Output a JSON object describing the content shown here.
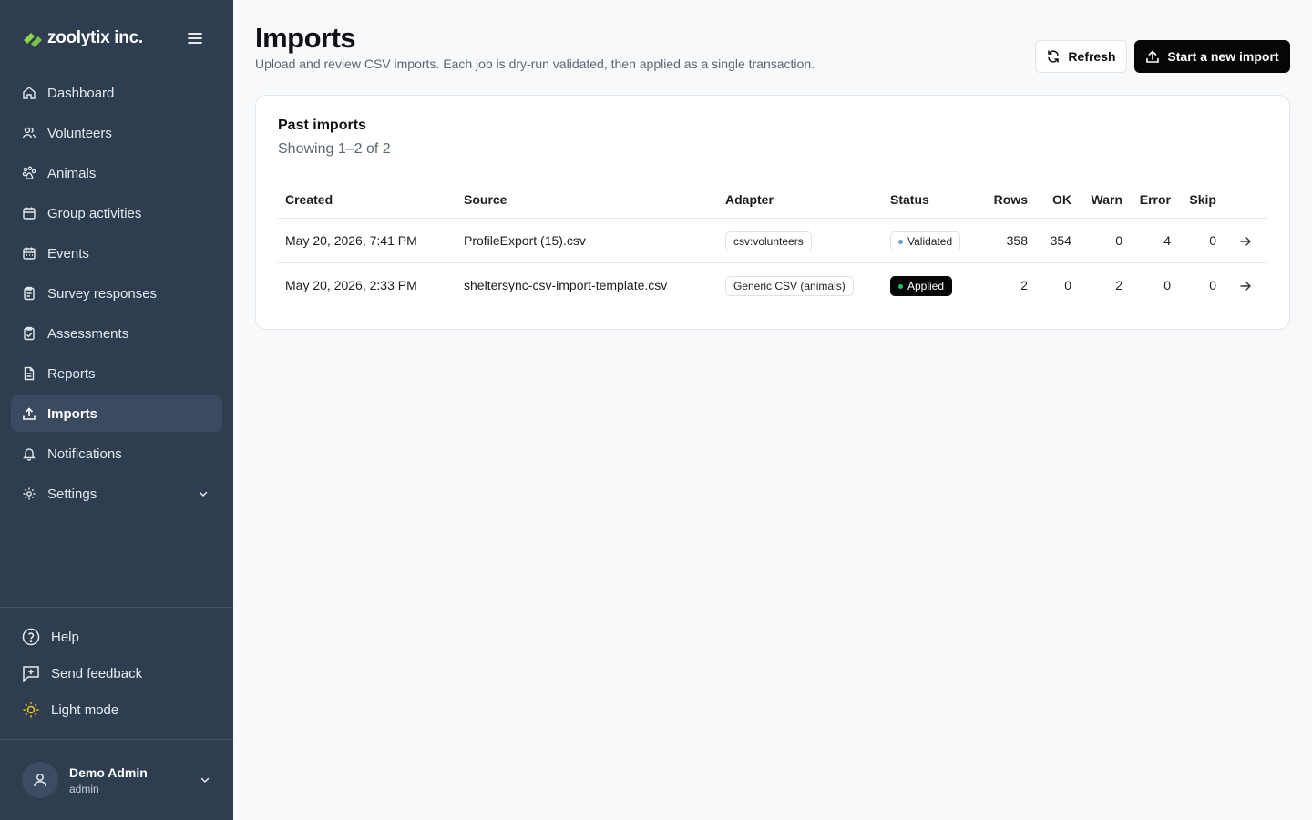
{
  "brand": {
    "name": "zoolytix inc."
  },
  "sidebar": {
    "items": [
      {
        "label": "Dashboard",
        "icon": "home-icon"
      },
      {
        "label": "Volunteers",
        "icon": "users-icon"
      },
      {
        "label": "Animals",
        "icon": "paw-icon"
      },
      {
        "label": "Group activities",
        "icon": "calendar-icon"
      },
      {
        "label": "Events",
        "icon": "calendar-icon"
      },
      {
        "label": "Survey responses",
        "icon": "clipboard-icon"
      },
      {
        "label": "Assessments",
        "icon": "clipboard-check-icon"
      },
      {
        "label": "Reports",
        "icon": "document-icon"
      },
      {
        "label": "Imports",
        "icon": "upload-icon",
        "active": true
      },
      {
        "label": "Notifications",
        "icon": "bell-icon"
      },
      {
        "label": "Settings",
        "icon": "gear-icon",
        "expandable": true
      }
    ],
    "utilities": [
      {
        "label": "Help",
        "icon": "help-circle-icon"
      },
      {
        "label": "Send feedback",
        "icon": "feedback-icon"
      },
      {
        "label": "Light mode",
        "icon": "sun-icon"
      }
    ],
    "user": {
      "name": "Demo Admin",
      "role": "admin"
    }
  },
  "header": {
    "title": "Imports",
    "subtitle": "Upload and review CSV imports. Each job is dry-run validated, then applied as a single transaction.",
    "refresh_label": "Refresh",
    "new_import_label": "Start a new import"
  },
  "card": {
    "title": "Past imports",
    "subtitle": "Showing 1–2 of 2"
  },
  "table": {
    "columns": [
      "Created",
      "Source",
      "Adapter",
      "Status",
      "Rows",
      "OK",
      "Warn",
      "Error",
      "Skip"
    ],
    "rows": [
      {
        "created": "May 20, 2026, 7:41 PM",
        "source": "ProfileExport (15).csv",
        "adapter": "csv:volunteers",
        "status": "Validated",
        "rows": "358",
        "ok": "354",
        "warn": "0",
        "error": "4",
        "skip": "0"
      },
      {
        "created": "May 20, 2026, 2:33 PM",
        "source": "sheltersync-csv-import-template.csv",
        "adapter": "Generic CSV (animals)",
        "status": "Applied",
        "rows": "2",
        "ok": "0",
        "warn": "2",
        "error": "0",
        "skip": "0"
      }
    ]
  },
  "colors": {
    "sidebar_bg": "#2e3e50",
    "active_item_bg": "#3a4b5f",
    "primary_button": "#050608",
    "validated_dot": "#6b9bd1",
    "applied_dot": "#22c55e",
    "brand_green": "#8bd94a",
    "sun_yellow": "#f5c518"
  }
}
